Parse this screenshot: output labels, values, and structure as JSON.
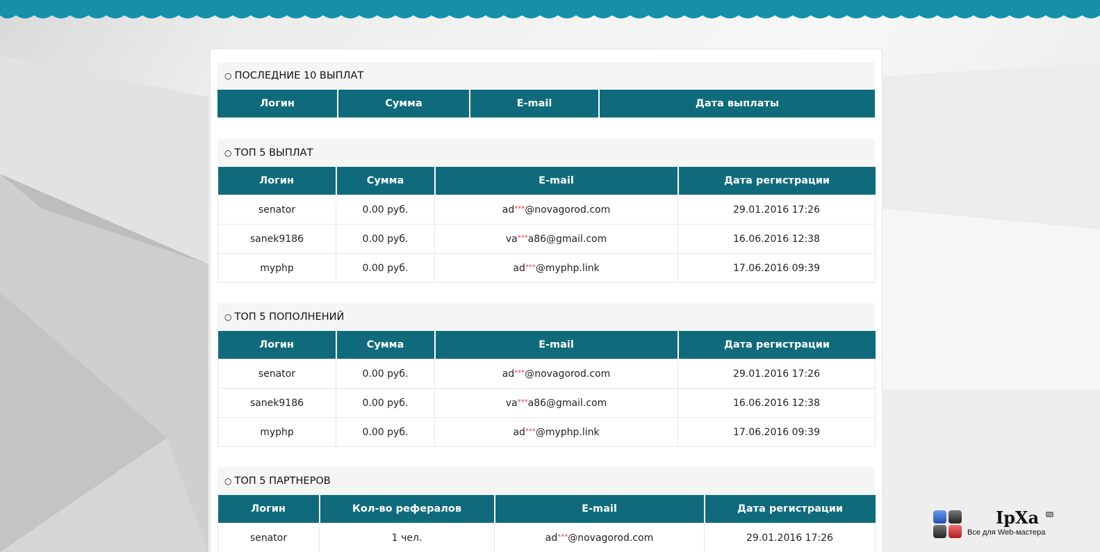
{
  "sections": [
    {
      "title": "ПОСЛЕДНИЕ 10 ВЫПЛАТ",
      "columns": [
        "Логин",
        "Сумма",
        "E-mail",
        "Дата выплаты"
      ],
      "rows": []
    },
    {
      "title": "ТОП 5 ВЫПЛАТ",
      "columns": [
        "Логин",
        "Сумма",
        "E-mail",
        "Дата регистрации"
      ],
      "rows": [
        {
          "login": "senator",
          "amount": "0.00 руб.",
          "email_pre": "ad",
          "email_mask": "***",
          "email_post": "@novagorod.com",
          "date": "29.01.2016 17:26"
        },
        {
          "login": "sanek9186",
          "amount": "0.00 руб.",
          "email_pre": "va",
          "email_mask": "***",
          "email_post": "a86@gmail.com",
          "date": "16.06.2016 12:38"
        },
        {
          "login": "myphp",
          "amount": "0.00 руб.",
          "email_pre": "ad",
          "email_mask": "***",
          "email_post": "@myphp.link",
          "date": "17.06.2016 09:39"
        }
      ]
    },
    {
      "title": "ТОП 5 ПОПОЛНЕНИЙ",
      "columns": [
        "Логин",
        "Сумма",
        "E-mail",
        "Дата регистрации"
      ],
      "rows": [
        {
          "login": "senator",
          "amount": "0.00 руб.",
          "email_pre": "ad",
          "email_mask": "***",
          "email_post": "@novagorod.com",
          "date": "29.01.2016 17:26"
        },
        {
          "login": "sanek9186",
          "amount": "0.00 руб.",
          "email_pre": "va",
          "email_mask": "***",
          "email_post": "a86@gmail.com",
          "date": "16.06.2016 12:38"
        },
        {
          "login": "myphp",
          "amount": "0.00 руб.",
          "email_pre": "ad",
          "email_mask": "***",
          "email_post": "@myphp.link",
          "date": "17.06.2016 09:39"
        }
      ]
    },
    {
      "title": "ТОП 5 ПАРТНЕРОВ",
      "columns": [
        "Логин",
        "Кол-во рефералов",
        "E-mail",
        "Дата регистрации"
      ],
      "rows": [
        {
          "login": "senator",
          "amount": "1 чел.",
          "email_pre": "ad",
          "email_mask": "***",
          "email_post": "@novagorod.com",
          "date": "29.01.2016 17:26"
        }
      ]
    }
  ],
  "watermark": {
    "name": "IpXa",
    "domain": "ru",
    "tagline": "Все для Web-мастера"
  },
  "colors": {
    "header_bg": "#0f6b7c",
    "wave": "#1690a8",
    "mask": "#e23b3b"
  }
}
